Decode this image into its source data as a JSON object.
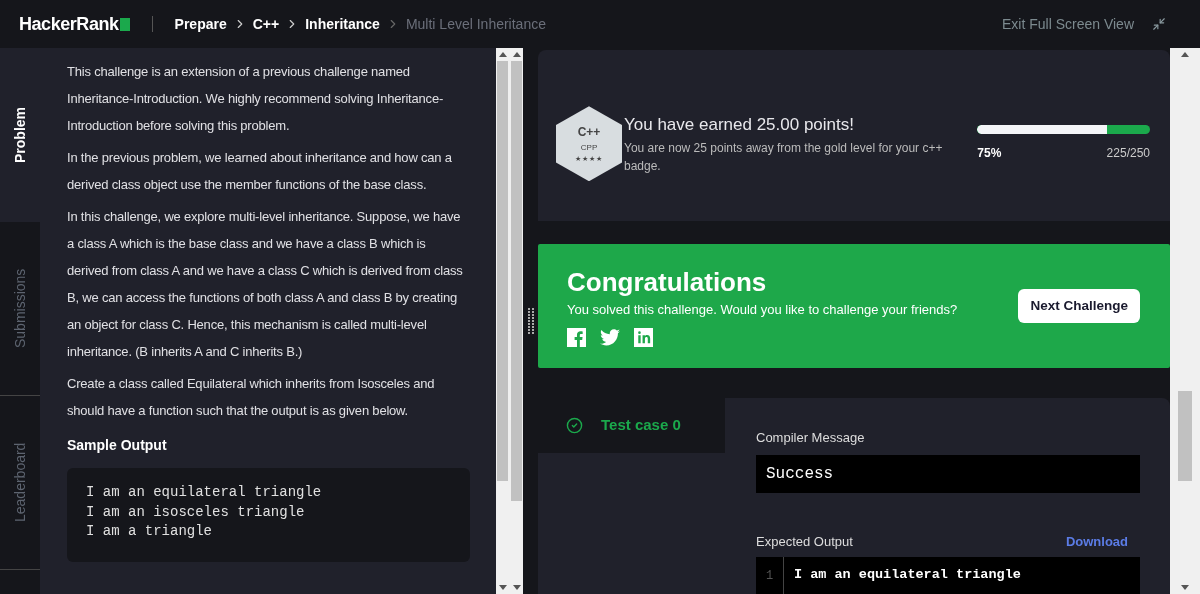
{
  "header": {
    "logo": "HackerRank",
    "breadcrumbs": [
      {
        "label": "Prepare",
        "current": false
      },
      {
        "label": "C++",
        "current": false
      },
      {
        "label": "Inheritance",
        "current": false
      },
      {
        "label": "Multi Level Inheritance",
        "current": true
      }
    ],
    "exit_link": "Exit Full Screen View"
  },
  "side_tabs": [
    {
      "label": "Problem",
      "selected": true
    },
    {
      "label": "Submissions",
      "selected": false
    },
    {
      "label": "Leaderboard",
      "selected": false
    }
  ],
  "problem": {
    "paragraphs": [
      "This challenge is an extension of a previous challenge named Inheritance-Introduction. We highly recommend solving Inheritance-Introduction before solving this problem.",
      "In the previous problem, we learned about inheritance and how can a derived class object use the member functions of the base class.",
      "In this challenge, we explore multi-level inheritance. Suppose, we have a class A which is the base class and we have a class B which is derived from class A and we have a class C which is derived from class B, we can access the functions of both class A and class B by creating an object for class C. Hence, this mechanism is called multi-level inheritance. (B inherits A and C inherits B.)",
      "Create a class called Equilateral which inherits from Isosceles and should have a function such that the output is as given below."
    ],
    "sample_heading": "Sample Output",
    "sample_lines": [
      "I am an equilateral triangle",
      "I am an isosceles triangle",
      "I am a triangle"
    ]
  },
  "points": {
    "badge_title": "C++",
    "badge_code": "CPP",
    "badge_stars": "★★★★",
    "title": "You have earned 25.00 points!",
    "subtitle": "You are now 25 points away from the gold level for your c++ badge.",
    "level": 0.75,
    "percent": "75%",
    "score": "225/250"
  },
  "congrats": {
    "title": "Congratulations",
    "message": "You solved this challenge. Would you like to challenge your friends?",
    "button": "Next Challenge"
  },
  "test_cases": [
    {
      "label": "Test case 0",
      "passed": true,
      "selected": true
    }
  ],
  "compiler": {
    "label": "Compiler Message",
    "value": "Success"
  },
  "expected": {
    "label": "Expected Output",
    "download": "Download",
    "lines": [
      {
        "number": "1",
        "text": "I am an equilateral triangle"
      }
    ]
  }
}
